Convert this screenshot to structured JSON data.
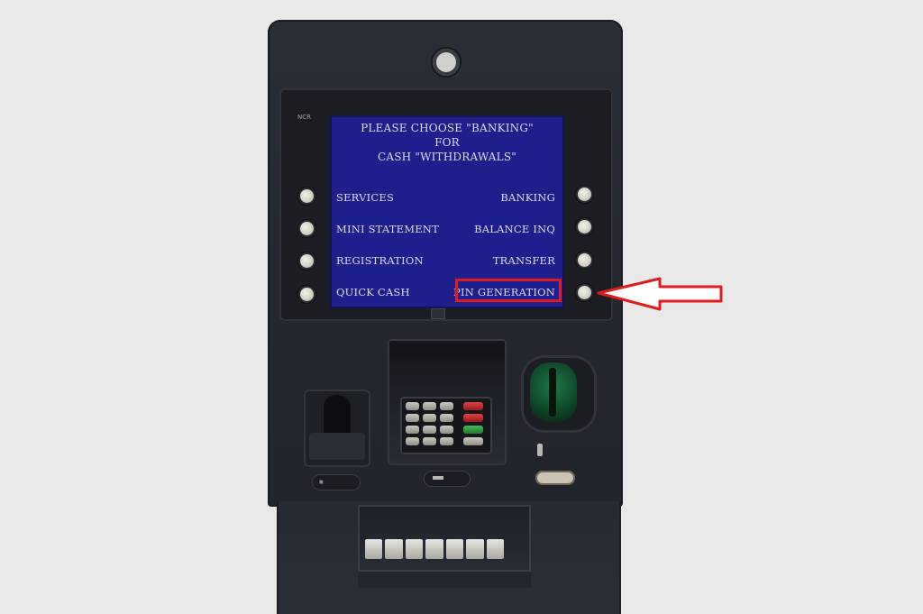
{
  "screen": {
    "header_line1": "PLEASE CHOOSE \"BANKING\"",
    "header_line2": "FOR",
    "header_line3": "CASH \"WITHDRAWALS\"",
    "left_options": [
      "SERVICES",
      "MINI STATEMENT",
      "REGISTRATION",
      "QUICK CASH"
    ],
    "right_options": [
      "BANKING",
      "BALANCE INQ",
      "TRANSFER",
      "PIN GENERATION"
    ],
    "highlighted_option": "PIN GENERATION"
  },
  "brand": {
    "text": "NCR"
  },
  "colors": {
    "screen_bg": "#1e1e8c",
    "highlight": "#e21c1c",
    "background": "#e9e9e9",
    "atm_body": "#2a2e36"
  },
  "annotation": {
    "icon": "left-arrow-icon",
    "points_to": "PIN GENERATION"
  }
}
